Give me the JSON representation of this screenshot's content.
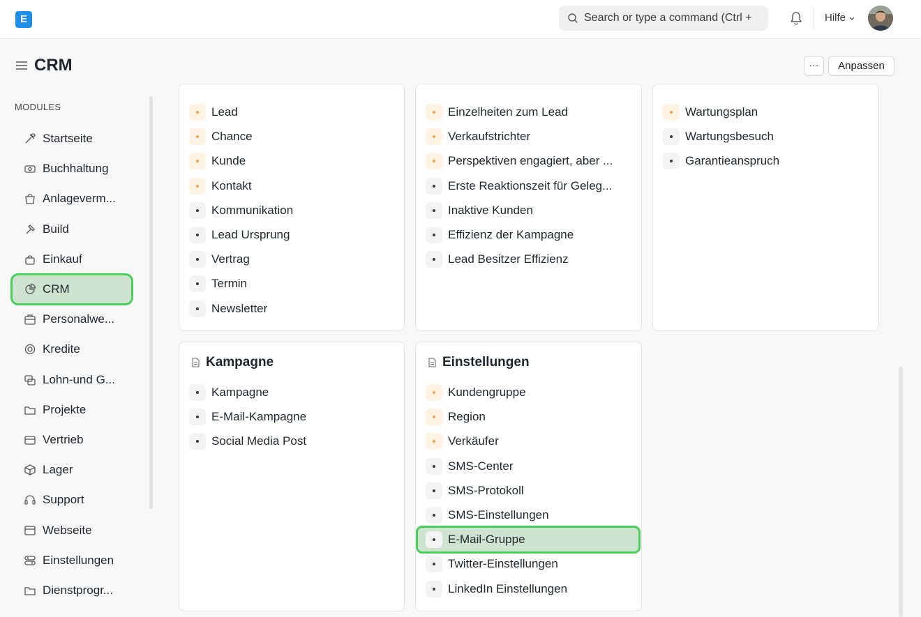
{
  "navbar": {
    "logo_letter": "E",
    "search_placeholder": "Search or type a command (Ctrl +",
    "help_label": "Hilfe"
  },
  "page": {
    "title": "CRM",
    "more_label": "···",
    "customize_label": "Anpassen"
  },
  "sidebar": {
    "section_label": "MODULES",
    "items": [
      {
        "label": "Startseite",
        "icon": "tools-icon"
      },
      {
        "label": "Buchhaltung",
        "icon": "money-icon"
      },
      {
        "label": "Anlageverm...",
        "icon": "bag-icon"
      },
      {
        "label": "Build",
        "icon": "hammer-icon"
      },
      {
        "label": "Einkauf",
        "icon": "shopping-icon"
      },
      {
        "label": "CRM",
        "icon": "pie-icon"
      },
      {
        "label": "Personalwe...",
        "icon": "briefcase-icon"
      },
      {
        "label": "Kredite",
        "icon": "loan-icon"
      },
      {
        "label": "Lohn-und G...",
        "icon": "payroll-icon"
      },
      {
        "label": "Projekte",
        "icon": "folder-icon"
      },
      {
        "label": "Vertrieb",
        "icon": "card-icon"
      },
      {
        "label": "Lager",
        "icon": "box-icon"
      },
      {
        "label": "Support",
        "icon": "headset-icon"
      },
      {
        "label": "Webseite",
        "icon": "web-icon"
      },
      {
        "label": "Einstellungen",
        "icon": "settings-icon"
      },
      {
        "label": "Dienstprogr...",
        "icon": "folder-icon"
      }
    ]
  },
  "cards": {
    "c1": {
      "links": [
        {
          "label": "Lead",
          "orange": true
        },
        {
          "label": "Chance",
          "orange": true
        },
        {
          "label": "Kunde",
          "orange": true
        },
        {
          "label": "Kontakt",
          "orange": true
        },
        {
          "label": "Kommunikation",
          "orange": false
        },
        {
          "label": "Lead Ursprung",
          "orange": false
        },
        {
          "label": "Vertrag",
          "orange": false
        },
        {
          "label": "Termin",
          "orange": false
        },
        {
          "label": "Newsletter",
          "orange": false
        }
      ]
    },
    "c2": {
      "links": [
        {
          "label": "Einzelheiten zum Lead",
          "orange": true
        },
        {
          "label": "Verkaufstrichter",
          "orange": true
        },
        {
          "label": "Perspektiven engagiert, aber ...",
          "orange": true
        },
        {
          "label": "Erste Reaktionszeit für Geleg...",
          "orange": false
        },
        {
          "label": "Inaktive Kunden",
          "orange": false
        },
        {
          "label": "Effizienz der Kampagne",
          "orange": false
        },
        {
          "label": "Lead Besitzer Effizienz",
          "orange": false
        }
      ]
    },
    "c3": {
      "links": [
        {
          "label": "Wartungsplan",
          "orange": true
        },
        {
          "label": "Wartungsbesuch",
          "orange": false
        },
        {
          "label": "Garantieanspruch",
          "orange": false
        }
      ]
    },
    "c4": {
      "title": "Kampagne",
      "links": [
        {
          "label": "Kampagne",
          "orange": false
        },
        {
          "label": "E-Mail-Kampagne",
          "orange": false
        },
        {
          "label": "Social Media Post",
          "orange": false
        }
      ]
    },
    "c5": {
      "title": "Einstellungen",
      "links": [
        {
          "label": "Kundengruppe",
          "orange": true
        },
        {
          "label": "Region",
          "orange": true
        },
        {
          "label": "Verkäufer",
          "orange": true
        },
        {
          "label": "SMS-Center",
          "orange": false
        },
        {
          "label": "SMS-Protokoll",
          "orange": false
        },
        {
          "label": "SMS-Einstellungen",
          "orange": false
        },
        {
          "label": "E-Mail-Gruppe",
          "orange": false
        },
        {
          "label": "Twitter-Einstellungen",
          "orange": false
        },
        {
          "label": "LinkedIn Einstellungen",
          "orange": false
        }
      ]
    }
  }
}
